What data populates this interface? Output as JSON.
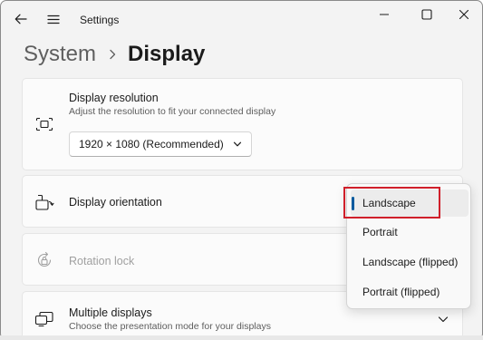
{
  "window": {
    "title": "Settings",
    "back_icon": "back-arrow-icon",
    "menu_icon": "hamburger-icon",
    "controls": [
      "minimize-icon",
      "maximize-icon",
      "close-icon"
    ]
  },
  "breadcrumb": {
    "parent": "System",
    "separator_icon": "chevron-right-icon",
    "current": "Display"
  },
  "cards": {
    "resolution": {
      "icon": "resize-screen-icon",
      "title": "Display resolution",
      "subtitle": "Adjust the resolution to fit your connected display",
      "selected_value": "1920 × 1080 (Recommended)"
    },
    "orientation": {
      "icon": "display-rotate-icon",
      "title": "Display orientation"
    },
    "rotation_lock": {
      "icon": "rotation-lock-icon",
      "title": "Rotation lock",
      "disabled": true
    },
    "multiple_displays": {
      "icon": "multiple-monitors-icon",
      "title": "Multiple displays",
      "subtitle": "Choose the presentation mode for your displays"
    }
  },
  "orientation_dropdown": {
    "options": [
      "Landscape",
      "Portrait",
      "Landscape (flipped)",
      "Portrait (flipped)"
    ],
    "selected": "Landscape"
  },
  "colors": {
    "accent": "#005a9e",
    "highlight_box": "#d01f2a",
    "window_bg": "#f3f3f3",
    "card_bg": "#fbfbfb"
  }
}
